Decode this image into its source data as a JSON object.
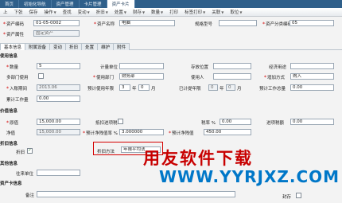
{
  "tabs": [
    "首页",
    "初始化导航",
    "资产管理",
    "卡片管理",
    "资产卡片"
  ],
  "toolbar": [
    {
      "label": "上",
      "caret": false
    },
    {
      "label": "下张",
      "caret": false
    },
    {
      "label": "保存",
      "caret": false
    },
    {
      "label": "操作",
      "caret": true
    },
    {
      "label": "查找",
      "caret": false
    },
    {
      "label": "变动",
      "caret": true
    },
    {
      "label": "折旧",
      "caret": true
    },
    {
      "label": "处置",
      "caret": true
    },
    {
      "label": "财存",
      "caret": true
    },
    {
      "label": "数量",
      "caret": true
    },
    {
      "label": "打印",
      "caret": false
    },
    {
      "label": "标签打印",
      "caret": true
    },
    {
      "label": "关联",
      "caret": true
    },
    {
      "label": "取位",
      "caret": true
    }
  ],
  "header": {
    "asset_code_label": "资产编码",
    "asset_code": "01-05-0002",
    "asset_name_label": "资产名称",
    "asset_name": "电脑",
    "spec_label": "规格型号",
    "category_label": "资产分类编码",
    "category": "05",
    "attr_label": "资产属性",
    "attr": "固定资产"
  },
  "subtabs": [
    "基本信息",
    "附属设备",
    "变动",
    "折旧",
    "处置",
    "维护",
    "附件"
  ],
  "usage": {
    "section": "使用信息",
    "qty_label": "数量",
    "qty": "5",
    "unit_label": "计量单位",
    "location_label": "存放位置",
    "purpose_label": "经济用途",
    "multi_dept_label": "多部门使用",
    "dept_label": "使用部门",
    "dept": "财务部",
    "user_label": "使用人",
    "add_method_label": "增加方式",
    "add_method": "购入",
    "date_label": "入账期间",
    "date": "2013.06",
    "life_label": "预计使用年限",
    "life_years": "3",
    "life_years_unit": "年",
    "life_months": "0",
    "life_months_unit": "月",
    "used_label": "已计提年限",
    "used_years": "0",
    "used_years_unit": "年",
    "used_months": "0",
    "used_months_unit": "月",
    "workload_label": "预计工作总量",
    "workload": "0.00",
    "acc_workload_label": "累计工作量",
    "acc_workload": "0.00"
  },
  "value": {
    "section": "价值信息",
    "orig_label": "原值",
    "orig": "15,000.00",
    "tax_in_label": "抵扣进项税",
    "tax_rate_label": "税率 %",
    "tax_rate": "0.00",
    "input_tax_label": "进项税额",
    "input_tax": "0.00",
    "net_label": "净值",
    "net": "15,000.00",
    "salvage_rate_label": "预计净残值率 %",
    "salvage_rate": "3.000000",
    "salvage_label": "预计净残值",
    "salvage": "450.00"
  },
  "depr": {
    "section": "折旧信息",
    "flag_label": "折旧",
    "method_label": "折旧方法",
    "method": "年限平均法"
  },
  "other": {
    "section": "其他信息",
    "supplier_label": "往来单位",
    "card_section": "资产卡信息",
    "remark_label": "备注",
    "archived_label": "封存"
  },
  "watermark": {
    "cn": "用友软件下载",
    "url": "WWW.YYRJXZ.COM"
  },
  "colors": {
    "accent": "#2f5f8a",
    "required": "#d40000",
    "watermark_red": "#c80000",
    "watermark_blue": "#0077c8"
  }
}
